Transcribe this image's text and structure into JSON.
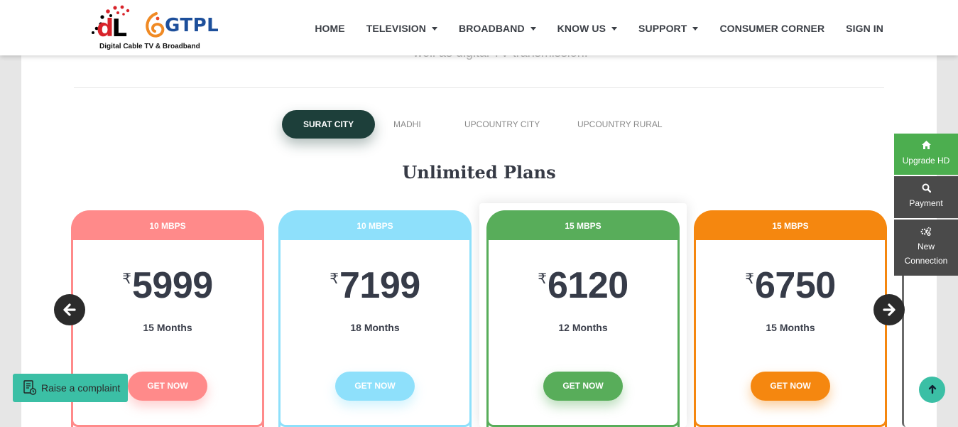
{
  "brand": {
    "dl_text_d": "d",
    "dl_text_l": "L",
    "gtpl": "GTPL",
    "tagline": "Digital Cable TV & Broadband",
    "brand_red": "#d8232a",
    "brand_blue": "#1d4f9b"
  },
  "nav": {
    "items": [
      {
        "label": "HOME",
        "dropdown": false
      },
      {
        "label": "TELEVISION",
        "dropdown": true
      },
      {
        "label": "BROADBAND",
        "dropdown": true
      },
      {
        "label": "KNOW US",
        "dropdown": true
      },
      {
        "label": "SUPPORT",
        "dropdown": true
      },
      {
        "label": "CONSUMER CORNER",
        "dropdown": false
      },
      {
        "label": "SIGN IN",
        "dropdown": false
      }
    ]
  },
  "intro_fragment": "well as digital TV transmission.",
  "tabs": [
    {
      "label": "SURAT CITY",
      "active": true
    },
    {
      "label": "MADHI",
      "active": false
    },
    {
      "label": "UPCOUNTRY CITY",
      "active": false
    },
    {
      "label": "UPCOUNTRY RURAL",
      "active": false
    }
  ],
  "section_title": "Unlimited Plans",
  "currency_symbol": "₹",
  "plans": [
    {
      "speed": "10 MBPS",
      "price": "5999",
      "duration": "15 Months",
      "cta": "GET NOW",
      "color": "#ff8a8a"
    },
    {
      "speed": "10 MBPS",
      "price": "7199",
      "duration": "18 Months",
      "cta": "GET NOW",
      "color": "#8ee0fb"
    },
    {
      "speed": "15 MBPS",
      "price": "6120",
      "duration": "12 Months",
      "cta": "GET NOW",
      "color": "#58ad5a"
    },
    {
      "speed": "15 MBPS",
      "price": "6750",
      "duration": "15 Months",
      "cta": "GET NOW",
      "color": "#f5870f"
    }
  ],
  "carousel": {
    "prev_icon": "arrow-left-icon",
    "next_icon": "arrow-right-icon"
  },
  "side_menu": [
    {
      "label": "Upgrade HD",
      "icon": "home-icon",
      "color": "#4cae4f"
    },
    {
      "label": "Payment",
      "icon": "search-icon",
      "color": "#4a4a4a"
    },
    {
      "label": "New Connection",
      "icon": "gears-icon",
      "color": "#4a4a4a"
    }
  ],
  "complaint_label": "Raise a complaint",
  "accent": "#3bbfa5"
}
